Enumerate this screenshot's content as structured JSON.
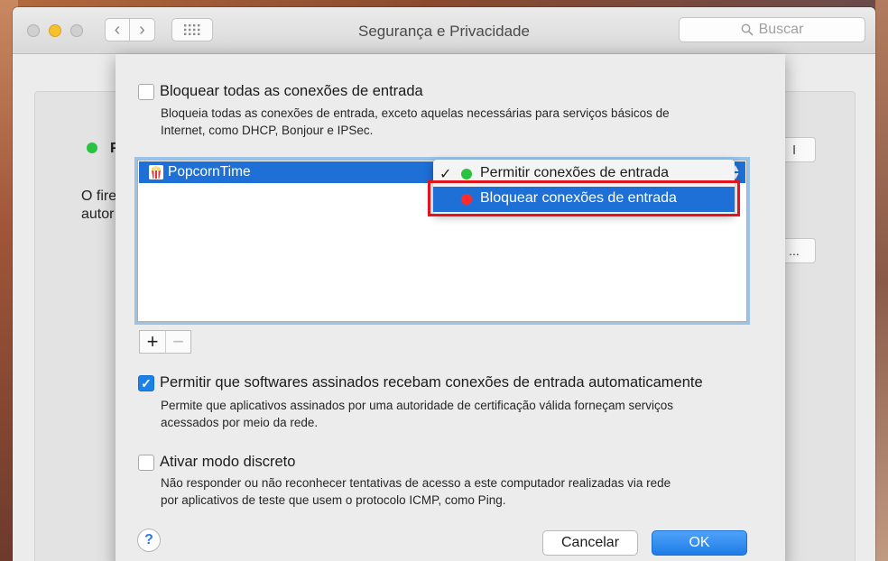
{
  "window": {
    "title": "Segurança e Privacidade",
    "search_placeholder": "Buscar"
  },
  "background_panel": {
    "status_text": "F",
    "line1": "O fire",
    "line2": "autor",
    "button1": "l",
    "button2": "..."
  },
  "sheet": {
    "block_all": {
      "label": "Bloquear todas as conexões de entrada",
      "checked": false,
      "desc_line1": "Bloqueia todas as conexões de entrada, exceto aquelas necessárias para serviços básicos de",
      "desc_line2": "Internet, como DHCP, Bonjour e IPSec."
    },
    "app_list": {
      "rows": [
        {
          "name": "PopcornTime",
          "setting": "Permitir conexões de entrada"
        }
      ]
    },
    "popup_menu": {
      "items": [
        {
          "label": "Permitir conexões de entrada",
          "checked": true,
          "dot_color": "#29c241"
        },
        {
          "label": "Bloquear conexões de entrada",
          "checked": false,
          "dot_color": "#ff2a2a",
          "highlighted": true
        }
      ]
    },
    "add_label": "+",
    "remove_label": "−",
    "signed": {
      "label": "Permitir que softwares assinados recebam conexões de entrada automaticamente",
      "checked": true,
      "desc_line1": "Permite que aplicativos assinados por uma autoridade de certificação válida forneçam serviços",
      "desc_line2": "acessados por meio da rede."
    },
    "stealth": {
      "label": "Ativar modo discreto",
      "checked": false,
      "desc_line1": "Não responder ou não reconhecer tentativas de acesso a este computador realizadas via rede",
      "desc_line2": "por aplicativos de teste que usem o protocolo ICMP, como Ping."
    },
    "help_label": "?",
    "cancel_label": "Cancelar",
    "ok_label": "OK"
  },
  "colors": {
    "accent": "#1e70d6",
    "highlight_box": "#e3141c",
    "allow_dot": "#29c241",
    "block_dot": "#ff2a2a"
  }
}
